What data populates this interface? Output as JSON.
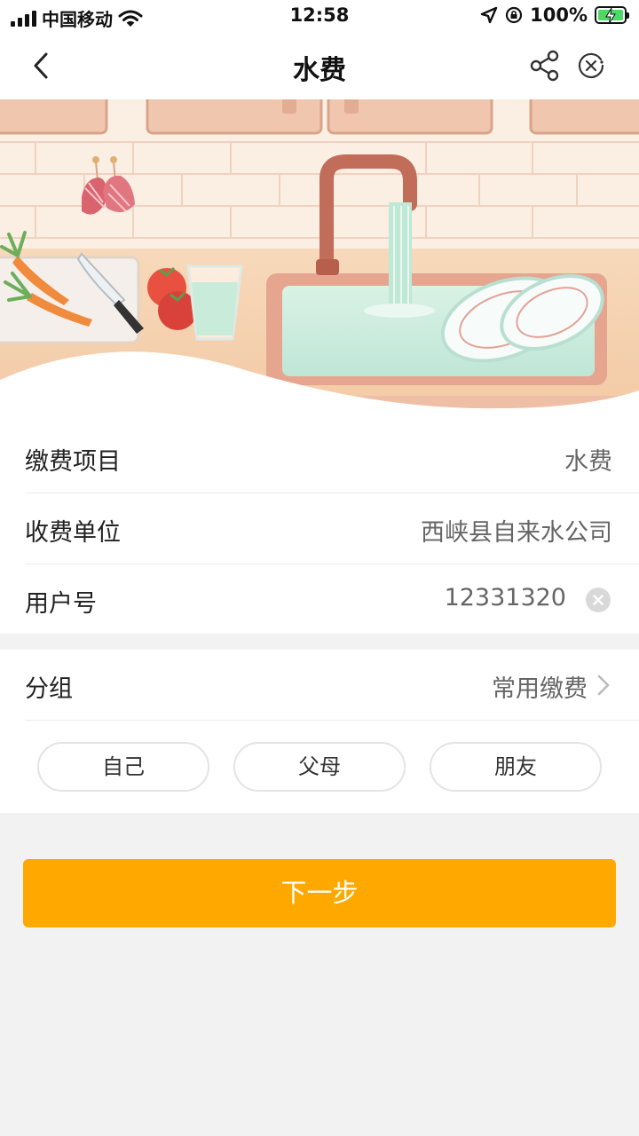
{
  "status_bar": {
    "carrier": "中国移动",
    "time": "12:58",
    "battery": "100%",
    "icons": [
      "signal-icon",
      "wifi-icon",
      "location-icon",
      "rotation-lock-icon",
      "battery-charging-icon"
    ]
  },
  "nav": {
    "title": "水费",
    "icons": [
      "back-icon",
      "share-icon",
      "close-icon"
    ]
  },
  "form": {
    "rows": [
      {
        "label": "缴费项目",
        "value": "水费"
      },
      {
        "label": "收费单位",
        "value": "西峡县自来水公司"
      },
      {
        "label": "用户号",
        "value": "12331320"
      }
    ],
    "group": {
      "label": "分组",
      "value": "常用缴费"
    },
    "chips": [
      "自己",
      "父母",
      "朋友"
    ]
  },
  "actions": {
    "next": "下一步"
  },
  "colors": {
    "accent": "#ffa800",
    "background": "#f2f2f2",
    "card": "#ffffff",
    "label": "#222222",
    "value": "#666666"
  }
}
